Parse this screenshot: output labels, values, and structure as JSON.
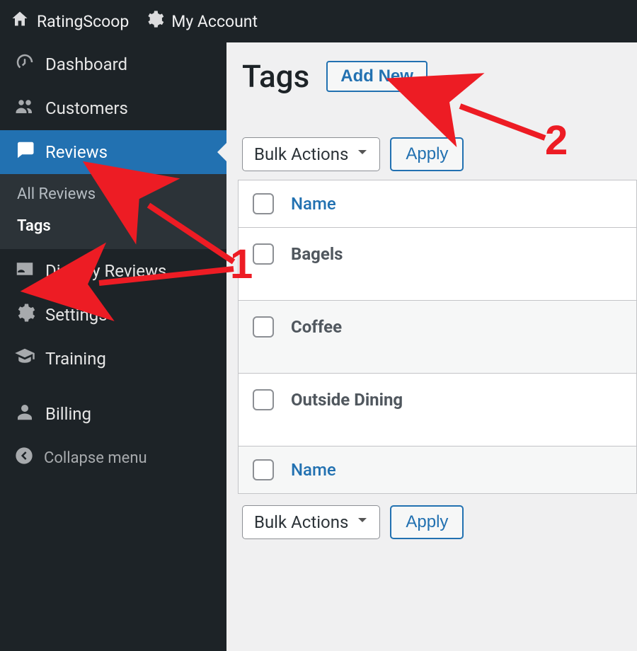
{
  "adminbar": {
    "site_name": "RatingScoop",
    "account_label": "My Account"
  },
  "sidebar": {
    "items": [
      {
        "id": "dashboard",
        "label": "Dashboard",
        "icon": "gauge"
      },
      {
        "id": "customers",
        "label": "Customers",
        "icon": "users"
      },
      {
        "id": "reviews",
        "label": "Reviews",
        "icon": "comment",
        "current": true
      },
      {
        "id": "display-reviews",
        "label": "Display Reviews",
        "icon": "id-card"
      },
      {
        "id": "settings",
        "label": "Settings",
        "icon": "gear"
      },
      {
        "id": "training",
        "label": "Training",
        "icon": "grad-cap"
      },
      {
        "id": "billing",
        "label": "Billing",
        "icon": "person"
      }
    ],
    "submenu": {
      "parent": "reviews",
      "items": [
        {
          "id": "all-reviews",
          "label": "All Reviews"
        },
        {
          "id": "tags",
          "label": "Tags",
          "current": true
        }
      ]
    },
    "collapse_label": "Collapse menu"
  },
  "page": {
    "title": "Tags",
    "add_new_label": "Add New"
  },
  "bulk": {
    "select_label": "Bulk Actions",
    "apply_label": "Apply"
  },
  "table": {
    "column_name": "Name",
    "rows": [
      {
        "name": "Bagels"
      },
      {
        "name": "Coffee"
      },
      {
        "name": "Outside Dining"
      }
    ]
  },
  "annotations": {
    "one": "1",
    "two": "2"
  }
}
